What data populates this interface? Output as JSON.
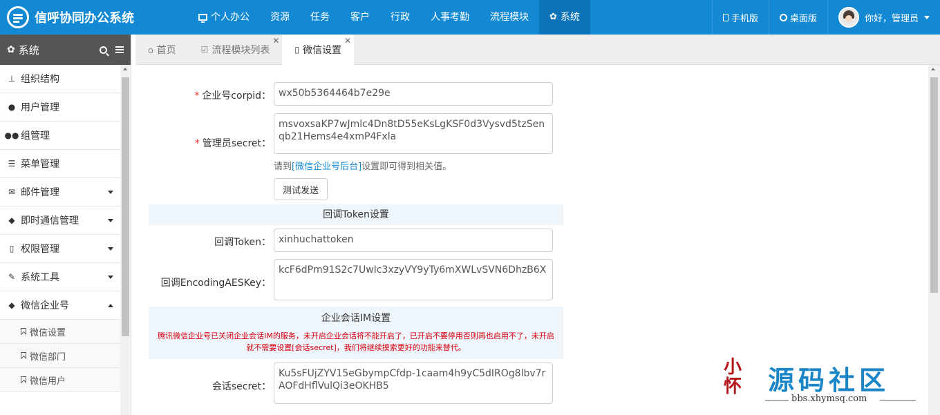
{
  "app": {
    "title": "信呼协同办公系统"
  },
  "nav": {
    "items": [
      "个人办公",
      "资源",
      "任务",
      "客户",
      "行政",
      "人事考勤",
      "流程模块",
      "系统"
    ],
    "active": "系统"
  },
  "right_nav": {
    "mobile": "手机版",
    "desktop": "桌面版",
    "greeting": "你好，管理员"
  },
  "sidebar": {
    "title": "系统",
    "items": [
      {
        "label": "组织结构",
        "icon": "sitemap-icon"
      },
      {
        "label": "用户管理",
        "icon": "user-icon"
      },
      {
        "label": "组管理",
        "icon": "users-icon"
      },
      {
        "label": "菜单管理",
        "icon": "list-icon"
      },
      {
        "label": "邮件管理",
        "icon": "envelope-icon"
      },
      {
        "label": "即时通信管理",
        "icon": "comment-icon"
      },
      {
        "label": "权限管理",
        "icon": "bookmark-icon"
      },
      {
        "label": "系统工具",
        "icon": "wrench-icon"
      },
      {
        "label": "微信企业号",
        "icon": "comments-icon"
      }
    ],
    "sub_items": [
      "微信设置",
      "微信部门",
      "微信用户"
    ]
  },
  "tabs": [
    {
      "label": "首页"
    },
    {
      "label": "流程模块列表"
    },
    {
      "label": "微信设置"
    }
  ],
  "form": {
    "corpid_label": "企业号corpid：",
    "corpid_value": "wx50b5364464b7e29e",
    "secret_label": "管理员secret：",
    "secret_value": "msvoxsaKP7wJmlc4Dn8tD55eKsLgKSF0d3Vysvd5tzSenqb21Hems4e4xmP4Fxla",
    "hint_prefix": "请到",
    "hint_link": "[微信企业号后台]",
    "hint_suffix": "设置即可得到相关值。",
    "test_button": "测试发送",
    "token_section": "回调Token设置",
    "token_label": "回调Token：",
    "token_value": "xinhuchattoken",
    "aeskey_label": "回调EncodingAESKey：",
    "aeskey_value": "kcF6dPm91S2c7UwIc3xzyVY9yTy6mXWLvSVN6DhzB6X",
    "im_section": "企业会话IM设置",
    "im_notice": "腾讯微信企业号已关闭企业会话IM的服务，未开启企业会话将不能开启了，已开启不要停用否则再也启用不了，未开启就不需要设置[会话secret]，我们将继续摸索更好的功能来替代。",
    "session_label": "会话secret：",
    "session_value": "Ku5sFUjZYV15eGbympCfdp-1caam4h9yC5dIROg8lbv7rAOFdHflVulQi3eOKHB5"
  },
  "watermark": {
    "seal": "小怀",
    "title": "源码社区",
    "url": "bbs.xhymsq.com"
  },
  "colors": {
    "primary": "#1389d4",
    "nav_active": "#0d73b8",
    "sidebar_head": "#555555",
    "required": "#ee3333",
    "notice": "#d9000d",
    "section_bg": "#eef5fb"
  }
}
